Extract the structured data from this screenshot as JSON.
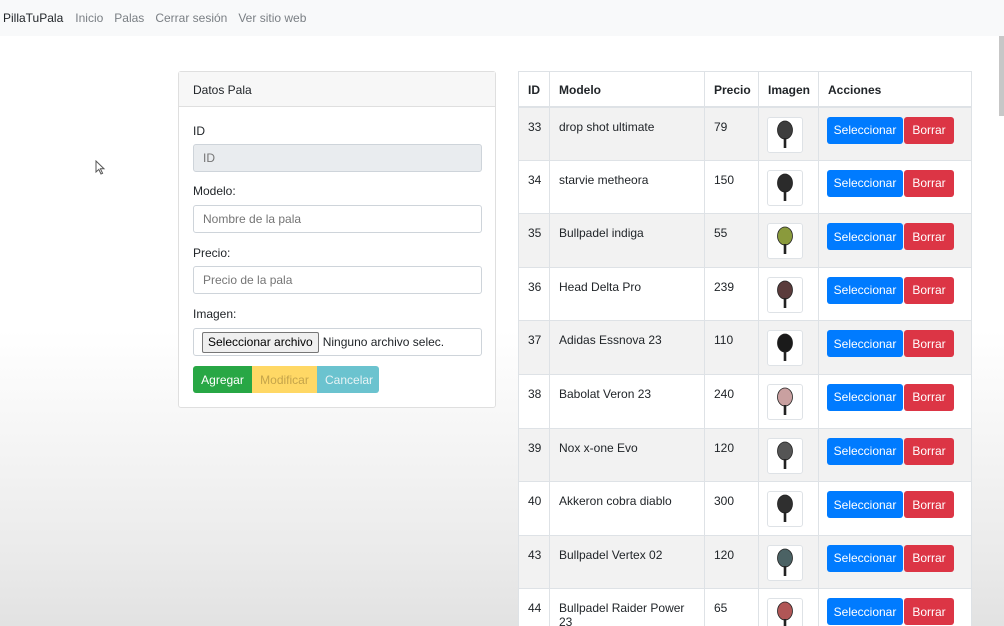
{
  "navbar": {
    "brand": "PillaTuPala",
    "links": [
      "Inicio",
      "Palas",
      "Cerrar sesión",
      "Ver sitio web"
    ]
  },
  "form": {
    "header": "Datos Pala",
    "id_label": "ID",
    "id_placeholder": "ID",
    "modelo_label": "Modelo:",
    "modelo_placeholder": "Nombre de la pala",
    "precio_label": "Precio:",
    "precio_placeholder": "Precio de la pala",
    "imagen_label": "Imagen:",
    "file_button": "Seleccionar archivo",
    "file_status": "Ninguno archivo selec.",
    "btn_agregar": "Agregar",
    "btn_modificar": "Modificar",
    "btn_cancelar": "Cancelar"
  },
  "table": {
    "headers": [
      "ID",
      "Modelo",
      "Precio",
      "Imagen",
      "Acciones"
    ],
    "select_label": "Seleccionar",
    "delete_label": "Borrar",
    "rows": [
      {
        "id": "33",
        "modelo": "drop shot ultimate",
        "precio": "79",
        "icon": "paddle-image-icon",
        "color": "#3d3d3d"
      },
      {
        "id": "34",
        "modelo": "starvie metheora",
        "precio": "150",
        "icon": "paddle-image-icon",
        "color": "#2b2b2b"
      },
      {
        "id": "35",
        "modelo": "Bullpadel indiga",
        "precio": "55",
        "icon": "paddle-image-icon",
        "color": "#8a9a3c"
      },
      {
        "id": "36",
        "modelo": "Head Delta Pro",
        "precio": "239",
        "icon": "paddle-image-icon",
        "color": "#5a3b3b"
      },
      {
        "id": "37",
        "modelo": "Adidas Essnova 23",
        "precio": "110",
        "icon": "paddle-image-icon",
        "color": "#1a1a1a"
      },
      {
        "id": "38",
        "modelo": "Babolat Veron 23",
        "precio": "240",
        "icon": "paddle-image-icon",
        "color": "#c9a0a0"
      },
      {
        "id": "39",
        "modelo": "Nox x-one Evo",
        "precio": "120",
        "icon": "paddle-image-icon",
        "color": "#555555"
      },
      {
        "id": "40",
        "modelo": "Akkeron cobra diablo",
        "precio": "300",
        "icon": "paddle-image-icon",
        "color": "#2f2f2f"
      },
      {
        "id": "43",
        "modelo": "Bullpadel Vertex 02",
        "precio": "120",
        "icon": "paddle-image-icon",
        "color": "#4b6264"
      },
      {
        "id": "44",
        "modelo": "Bullpadel Raider Power 23",
        "precio": "65",
        "icon": "paddle-image-icon",
        "color": "#b05656"
      }
    ]
  },
  "colors": {
    "primary": "#007bff",
    "danger": "#dc3545",
    "success": "#28a745",
    "warning": "#ffd865",
    "info": "#6bc3cf"
  }
}
